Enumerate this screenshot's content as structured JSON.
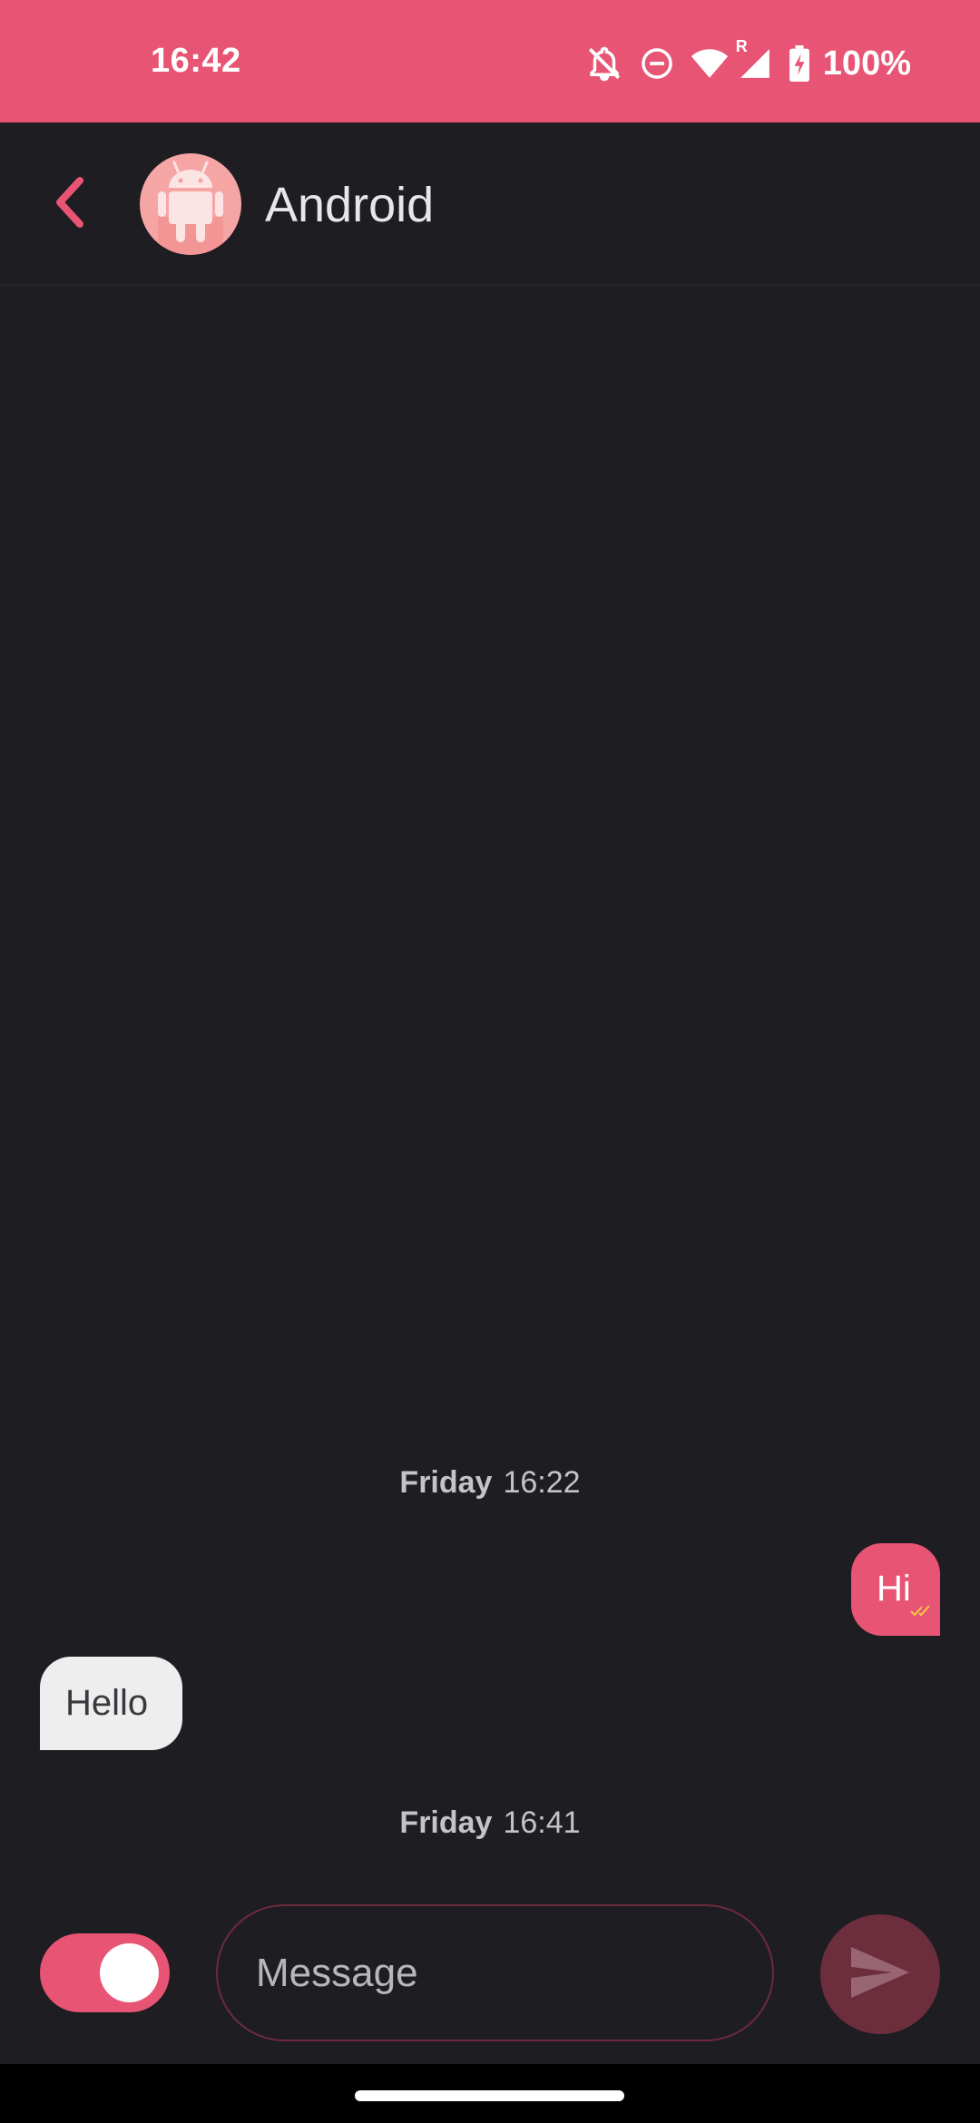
{
  "status_bar": {
    "time": "16:42",
    "battery": "100%",
    "roaming_indicator": "R",
    "icons": [
      "notifications-off-icon",
      "do-not-disturb-icon",
      "wifi-icon",
      "signal-icon",
      "battery-charging-icon"
    ]
  },
  "header": {
    "contact_name": "Android",
    "back_icon": "chevron-left-icon",
    "avatar_icon": "android-robot-icon"
  },
  "conversation": {
    "separators": [
      {
        "day": "Friday",
        "time": "16:22"
      },
      {
        "day": "Friday",
        "time": "16:41"
      }
    ],
    "messages": [
      {
        "direction": "outgoing",
        "text": "Hi",
        "status_icon": "double-check-icon"
      },
      {
        "direction": "incoming",
        "text": "Hello"
      }
    ]
  },
  "composer": {
    "placeholder": "Message",
    "value": "",
    "toggle_on": true,
    "send_icon": "send-icon"
  },
  "colors": {
    "accent": "#e85474",
    "background": "#1e1d22",
    "incoming_bubble": "#eeeeef",
    "send_button": "#6c2d3d",
    "read_ticks": "#f5c542"
  }
}
